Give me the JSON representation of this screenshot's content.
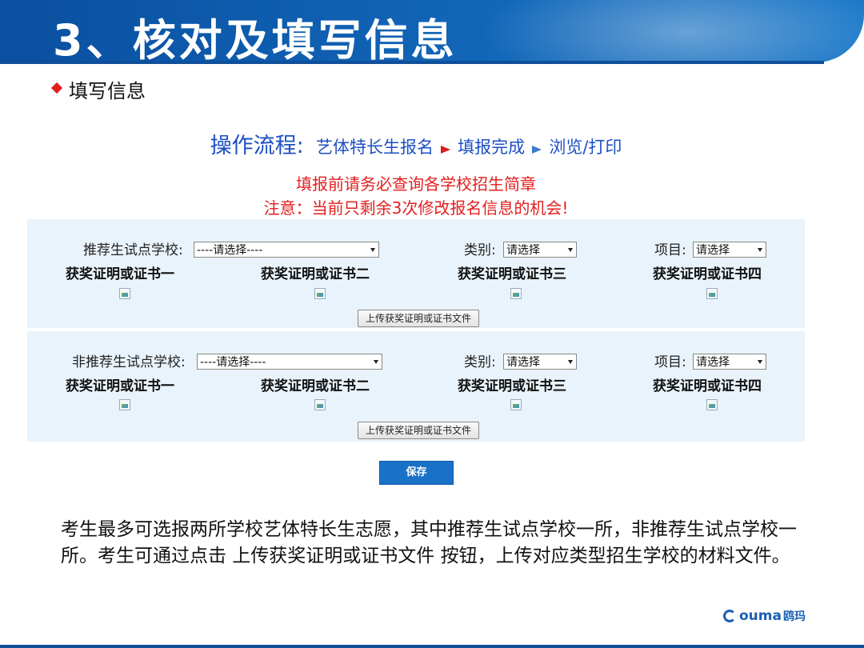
{
  "slide": {
    "title": "3、核对及填写信息",
    "subheading": "填写信息",
    "paragraph": "考生最多可选报两所学校艺体特长生志愿，其中推荐生试点学校一所，非推荐生试点学校一所。考生可通过点击 上传获奖证明或证书文件 按钮，上传对应类型招生学校的材料文件。",
    "logo_text": "ouma",
    "logo_cn": "鸥玛"
  },
  "form": {
    "flow_title": "操作流程:",
    "flow_steps": [
      "艺体特长生报名",
      "填报完成",
      "浏览/打印"
    ],
    "notice_line1": "填报前请务必查询各学校招生简章",
    "notice_line2": "注意：当前只剩余3次修改报名信息的机会!",
    "sections": [
      {
        "school_label": "推荐生试点学校:",
        "school_select": "----请选择----",
        "category_label": "类别:",
        "category_select": "请选择",
        "item_label": "项目:",
        "item_select": "请选择",
        "certificates": [
          "获奖证明或证书一",
          "获奖证明或证书二",
          "获奖证明或证书三",
          "获奖证明或证书四"
        ],
        "upload_button": "上传获奖证明或证书文件"
      },
      {
        "school_label": "非推荐生试点学校:",
        "school_select": "----请选择----",
        "category_label": "类别:",
        "category_select": "请选择",
        "item_label": "项目:",
        "item_select": "请选择",
        "certificates": [
          "获奖证明或证书一",
          "获奖证明或证书二",
          "获奖证明或证书三",
          "获奖证明或证书四"
        ],
        "upload_button": "上传获奖证明或证书文件"
      }
    ],
    "save_button": "保存"
  },
  "colors": {
    "banner": "#1266b8",
    "notice": "#e31e1e",
    "flow": "#1d4fc4",
    "save": "#1a72c8"
  }
}
